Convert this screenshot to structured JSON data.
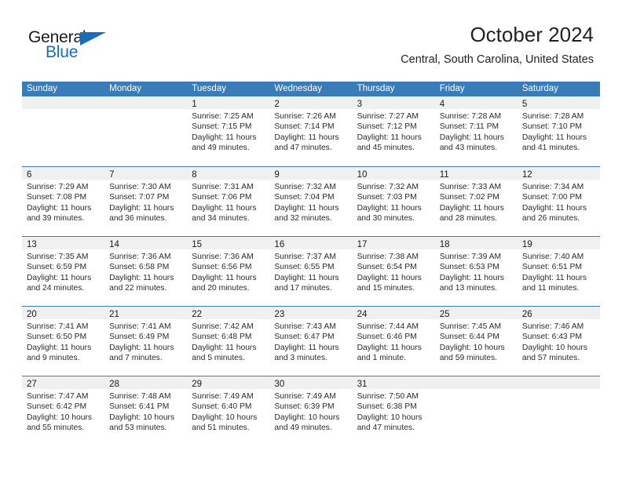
{
  "brand": {
    "word_one": "General",
    "word_two": "Blue",
    "triangle_icon": "triangle-icon"
  },
  "header": {
    "title": "October 2024",
    "subtitle": "Central, South Carolina, United States"
  },
  "colors": {
    "header_blue": "#3a7cb8",
    "brand_blue": "#1b6cb5",
    "day_band_gray": "#f0f0f0",
    "text": "#2b2b2b"
  },
  "weekdays": [
    "Sunday",
    "Monday",
    "Tuesday",
    "Wednesday",
    "Thursday",
    "Friday",
    "Saturday"
  ],
  "weeks": [
    [
      {
        "day": "",
        "lines": []
      },
      {
        "day": "",
        "lines": []
      },
      {
        "day": "1",
        "lines": [
          "Sunrise: 7:25 AM",
          "Sunset: 7:15 PM",
          "Daylight: 11 hours",
          "and 49 minutes."
        ]
      },
      {
        "day": "2",
        "lines": [
          "Sunrise: 7:26 AM",
          "Sunset: 7:14 PM",
          "Daylight: 11 hours",
          "and 47 minutes."
        ]
      },
      {
        "day": "3",
        "lines": [
          "Sunrise: 7:27 AM",
          "Sunset: 7:12 PM",
          "Daylight: 11 hours",
          "and 45 minutes."
        ]
      },
      {
        "day": "4",
        "lines": [
          "Sunrise: 7:28 AM",
          "Sunset: 7:11 PM",
          "Daylight: 11 hours",
          "and 43 minutes."
        ]
      },
      {
        "day": "5",
        "lines": [
          "Sunrise: 7:28 AM",
          "Sunset: 7:10 PM",
          "Daylight: 11 hours",
          "and 41 minutes."
        ]
      }
    ],
    [
      {
        "day": "6",
        "lines": [
          "Sunrise: 7:29 AM",
          "Sunset: 7:08 PM",
          "Daylight: 11 hours",
          "and 39 minutes."
        ]
      },
      {
        "day": "7",
        "lines": [
          "Sunrise: 7:30 AM",
          "Sunset: 7:07 PM",
          "Daylight: 11 hours",
          "and 36 minutes."
        ]
      },
      {
        "day": "8",
        "lines": [
          "Sunrise: 7:31 AM",
          "Sunset: 7:06 PM",
          "Daylight: 11 hours",
          "and 34 minutes."
        ]
      },
      {
        "day": "9",
        "lines": [
          "Sunrise: 7:32 AM",
          "Sunset: 7:04 PM",
          "Daylight: 11 hours",
          "and 32 minutes."
        ]
      },
      {
        "day": "10",
        "lines": [
          "Sunrise: 7:32 AM",
          "Sunset: 7:03 PM",
          "Daylight: 11 hours",
          "and 30 minutes."
        ]
      },
      {
        "day": "11",
        "lines": [
          "Sunrise: 7:33 AM",
          "Sunset: 7:02 PM",
          "Daylight: 11 hours",
          "and 28 minutes."
        ]
      },
      {
        "day": "12",
        "lines": [
          "Sunrise: 7:34 AM",
          "Sunset: 7:00 PM",
          "Daylight: 11 hours",
          "and 26 minutes."
        ]
      }
    ],
    [
      {
        "day": "13",
        "lines": [
          "Sunrise: 7:35 AM",
          "Sunset: 6:59 PM",
          "Daylight: 11 hours",
          "and 24 minutes."
        ]
      },
      {
        "day": "14",
        "lines": [
          "Sunrise: 7:36 AM",
          "Sunset: 6:58 PM",
          "Daylight: 11 hours",
          "and 22 minutes."
        ]
      },
      {
        "day": "15",
        "lines": [
          "Sunrise: 7:36 AM",
          "Sunset: 6:56 PM",
          "Daylight: 11 hours",
          "and 20 minutes."
        ]
      },
      {
        "day": "16",
        "lines": [
          "Sunrise: 7:37 AM",
          "Sunset: 6:55 PM",
          "Daylight: 11 hours",
          "and 17 minutes."
        ]
      },
      {
        "day": "17",
        "lines": [
          "Sunrise: 7:38 AM",
          "Sunset: 6:54 PM",
          "Daylight: 11 hours",
          "and 15 minutes."
        ]
      },
      {
        "day": "18",
        "lines": [
          "Sunrise: 7:39 AM",
          "Sunset: 6:53 PM",
          "Daylight: 11 hours",
          "and 13 minutes."
        ]
      },
      {
        "day": "19",
        "lines": [
          "Sunrise: 7:40 AM",
          "Sunset: 6:51 PM",
          "Daylight: 11 hours",
          "and 11 minutes."
        ]
      }
    ],
    [
      {
        "day": "20",
        "lines": [
          "Sunrise: 7:41 AM",
          "Sunset: 6:50 PM",
          "Daylight: 11 hours",
          "and 9 minutes."
        ]
      },
      {
        "day": "21",
        "lines": [
          "Sunrise: 7:41 AM",
          "Sunset: 6:49 PM",
          "Daylight: 11 hours",
          "and 7 minutes."
        ]
      },
      {
        "day": "22",
        "lines": [
          "Sunrise: 7:42 AM",
          "Sunset: 6:48 PM",
          "Daylight: 11 hours",
          "and 5 minutes."
        ]
      },
      {
        "day": "23",
        "lines": [
          "Sunrise: 7:43 AM",
          "Sunset: 6:47 PM",
          "Daylight: 11 hours",
          "and 3 minutes."
        ]
      },
      {
        "day": "24",
        "lines": [
          "Sunrise: 7:44 AM",
          "Sunset: 6:46 PM",
          "Daylight: 11 hours",
          "and 1 minute."
        ]
      },
      {
        "day": "25",
        "lines": [
          "Sunrise: 7:45 AM",
          "Sunset: 6:44 PM",
          "Daylight: 10 hours",
          "and 59 minutes."
        ]
      },
      {
        "day": "26",
        "lines": [
          "Sunrise: 7:46 AM",
          "Sunset: 6:43 PM",
          "Daylight: 10 hours",
          "and 57 minutes."
        ]
      }
    ],
    [
      {
        "day": "27",
        "lines": [
          "Sunrise: 7:47 AM",
          "Sunset: 6:42 PM",
          "Daylight: 10 hours",
          "and 55 minutes."
        ]
      },
      {
        "day": "28",
        "lines": [
          "Sunrise: 7:48 AM",
          "Sunset: 6:41 PM",
          "Daylight: 10 hours",
          "and 53 minutes."
        ]
      },
      {
        "day": "29",
        "lines": [
          "Sunrise: 7:49 AM",
          "Sunset: 6:40 PM",
          "Daylight: 10 hours",
          "and 51 minutes."
        ]
      },
      {
        "day": "30",
        "lines": [
          "Sunrise: 7:49 AM",
          "Sunset: 6:39 PM",
          "Daylight: 10 hours",
          "and 49 minutes."
        ]
      },
      {
        "day": "31",
        "lines": [
          "Sunrise: 7:50 AM",
          "Sunset: 6:38 PM",
          "Daylight: 10 hours",
          "and 47 minutes."
        ]
      },
      {
        "day": "",
        "lines": []
      },
      {
        "day": "",
        "lines": []
      }
    ]
  ]
}
